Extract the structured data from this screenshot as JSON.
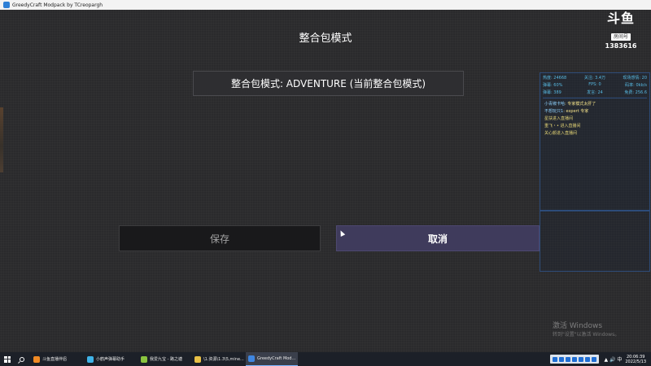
{
  "window": {
    "title": "GreedyCraft Modpack by TCreopargh"
  },
  "screen": {
    "title": "整合包模式",
    "mode_button_label": "整合包模式: ADVENTURE (当前整合包模式)",
    "save_label": "保存",
    "cancel_label": "取消"
  },
  "overlay": {
    "logo_text": "斗鱼",
    "logo_sub": "房间号",
    "room_id": "1383616",
    "stats": [
      {
        "label": "热度: 24668"
      },
      {
        "label": "关注: 3.4万"
      },
      {
        "label": "现场感情: 20"
      },
      {
        "label": "弹幕: 60%"
      },
      {
        "label": "FPS: 0"
      },
      {
        "label": "码率: 0kb/s"
      },
      {
        "label": "弹幕: 389"
      },
      {
        "label": "发言: 24"
      },
      {
        "label": "免费: 256.6"
      }
    ],
    "chat": [
      {
        "nick": "小青椒卡哈",
        "msg": ": 专家模式太肝了"
      },
      {
        "nick": "不想玩只1",
        "msg": ": expert 专家"
      },
      {
        "nick": "",
        "msg": "星扶进入直播间"
      },
      {
        "nick": "",
        "msg": "重飞・• 进入直播间"
      },
      {
        "nick": "",
        "msg": "关心颜进入直播间"
      }
    ]
  },
  "watermark": {
    "title": "激活 Windows",
    "subtitle": "转到\"设置\"以激活 Windows。"
  },
  "taskbar": {
    "items": [
      {
        "label": "斗鱼直播伴侣",
        "color": "#f08a24"
      },
      {
        "label": "小鹤声弹幕助手",
        "color": "#3fb3e8"
      },
      {
        "label": "我爱九宝 - 路之塘",
        "color": "#8ac43f"
      },
      {
        "label": "\\1.资源\\1.3\\5,mine...",
        "color": "#e8c046"
      },
      {
        "label": "GreedyCraft Mod...",
        "color": "#3f86e0",
        "active": true
      }
    ],
    "tray_glyph": "▲ 🔊 中",
    "time": "20:06:39",
    "date": "2022/5/13"
  }
}
